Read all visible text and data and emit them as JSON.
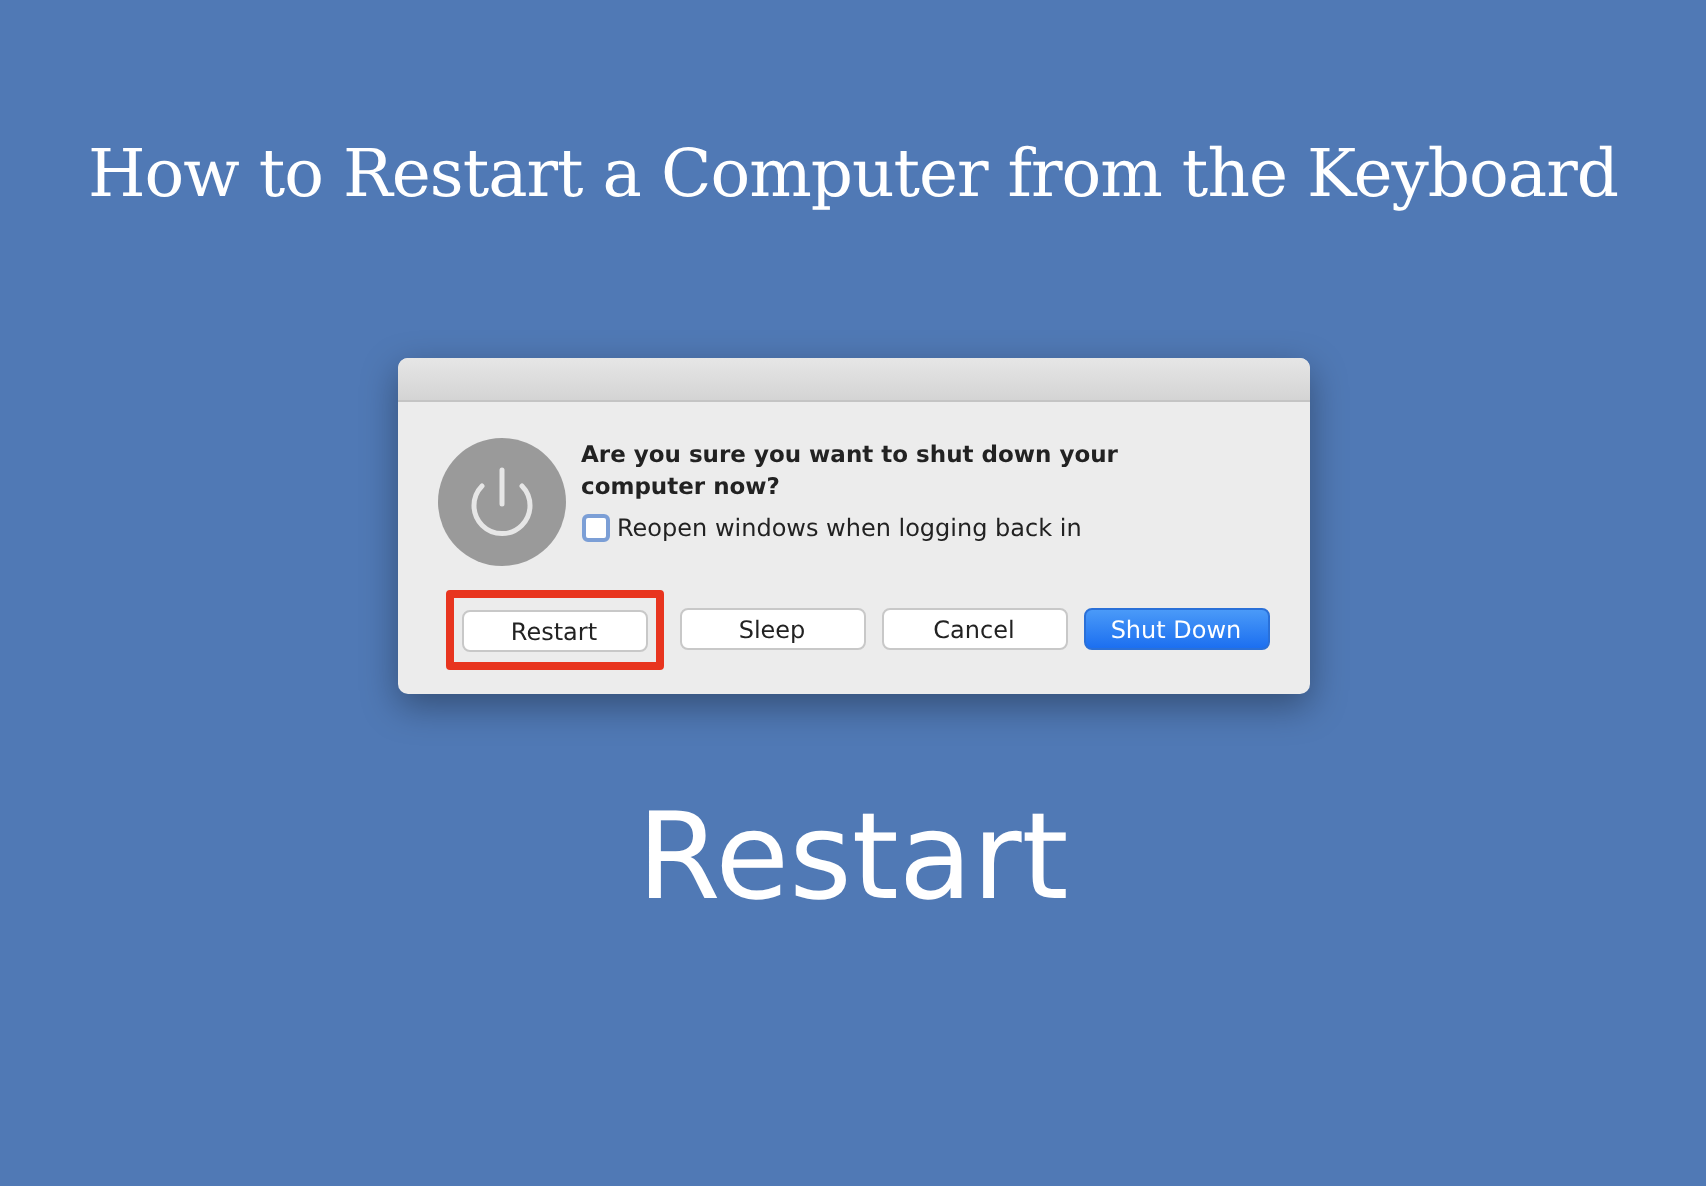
{
  "heading": "How to Restart a Computer from the Keyboard",
  "dialog": {
    "message": "Are you sure you want to shut down your computer now?",
    "checkbox": {
      "label": "Reopen windows when logging back in",
      "checked": false
    },
    "buttons": [
      {
        "label": "Restart",
        "kind": "default",
        "highlighted": true
      },
      {
        "label": "Sleep",
        "kind": "default",
        "highlighted": false
      },
      {
        "label": "Cancel",
        "kind": "default",
        "highlighted": false
      },
      {
        "label": "Shut Down",
        "kind": "primary",
        "highlighted": false
      }
    ]
  },
  "caption": "Restart"
}
